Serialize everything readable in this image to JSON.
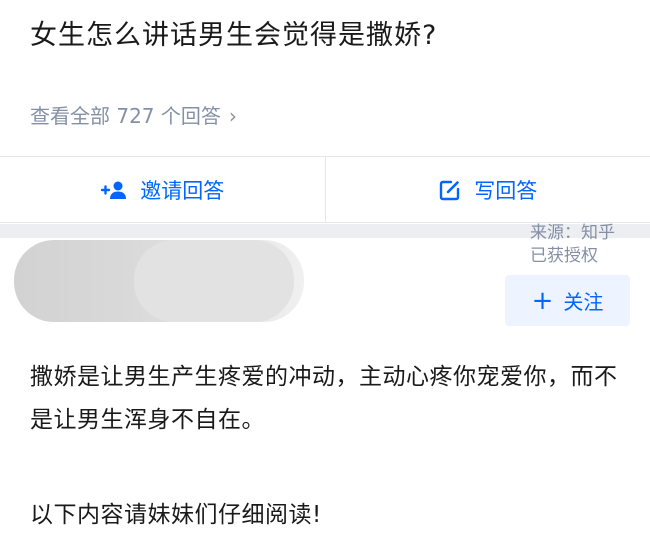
{
  "question": {
    "title": "女生怎么讲话男生会觉得是撒娇?",
    "view_all": "查看全部 727 个回答",
    "view_all_chevron": "›"
  },
  "actions": {
    "invite_label": "邀请回答",
    "invite_icon": "add-user-icon",
    "write_label": "写回答",
    "write_icon": "edit-icon"
  },
  "source": {
    "line1": "来源：知乎",
    "line2": "已获授权"
  },
  "author": {
    "follow_label": "关注",
    "follow_plus": "+"
  },
  "answer": {
    "paragraph1": "撒娇是让男生产生疼爱的冲动，主动心疼你宠爱你，而不是让男生浑身不自在。",
    "paragraph2": "以下内容请妹妹们仔细阅读!"
  },
  "colors": {
    "accent": "#0066ff",
    "muted": "#8590a6",
    "follow_bg": "#eef4ff"
  }
}
